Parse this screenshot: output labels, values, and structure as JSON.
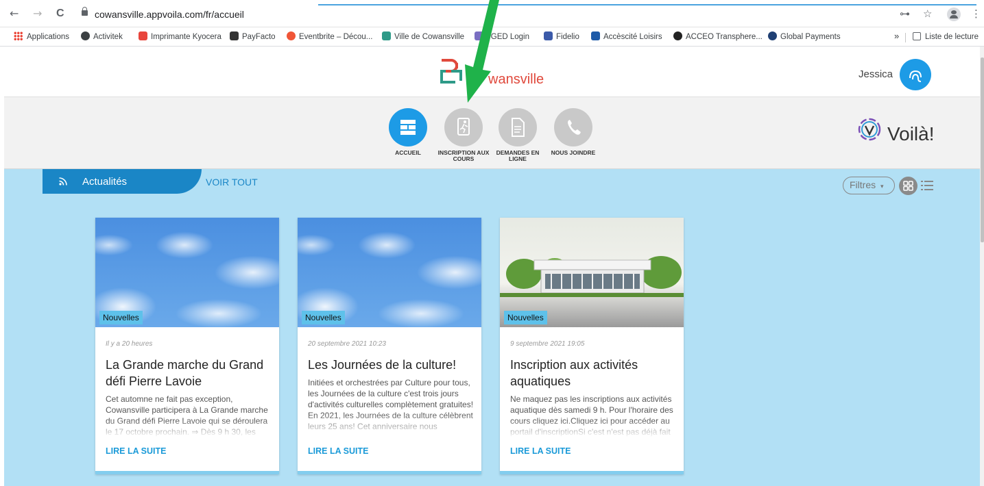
{
  "browser": {
    "url": "cowansville.appvoila.com/fr/accueil",
    "back_glyph": "←",
    "forward_glyph": "→",
    "reload_glyph": "C",
    "key_glyph": "⊶",
    "star_glyph": "☆",
    "menu_glyph": "⋮"
  },
  "bookmarks": {
    "items": [
      {
        "label": "Applications",
        "icon": "apps-grid-icon",
        "color": "#ea4335"
      },
      {
        "label": "Activitek",
        "icon": "activitek-icon",
        "color": "#3c4043"
      },
      {
        "label": "Imprimante Kyocera",
        "icon": "kyocera-icon",
        "color": "#e8453c"
      },
      {
        "label": "PayFacto",
        "icon": "payfacto-icon",
        "color": "#333333"
      },
      {
        "label": "Eventbrite – Décou...",
        "icon": "eventbrite-icon",
        "color": "#f05537"
      },
      {
        "label": "Ville de Cowansville",
        "icon": "cowansville-icon",
        "color": "#2e9a88"
      },
      {
        "label": "yGED Login",
        "icon": "yged-icon",
        "color": "#7a6fc2"
      },
      {
        "label": "Fidelio",
        "icon": "fidelio-icon",
        "color": "#3b5aa9"
      },
      {
        "label": "Accèscité Loisirs",
        "icon": "accescite-icon",
        "color": "#1e5ba8"
      },
      {
        "label": "ACCEO Transphere...",
        "icon": "acceo-icon",
        "color": "#222222"
      },
      {
        "label": "Global Payments",
        "icon": "global-payments-icon",
        "color": "#1f3f73"
      }
    ],
    "more_glyph": "»",
    "reading_list_label": "Liste de lecture"
  },
  "header": {
    "logo_text": "wansville",
    "user_name": "Jessica",
    "accent_color": "#1d9be6",
    "logo_color": "#e0493c"
  },
  "nav": {
    "items": [
      {
        "label_line1": "ACCUEIL",
        "label_line2": "",
        "icon": "home-grid-icon",
        "active": true
      },
      {
        "label_line1": "INSCRIPTION AUX",
        "label_line2": "COURS",
        "icon": "runner-icon",
        "active": false
      },
      {
        "label_line1": "DEMANDES EN",
        "label_line2": "LIGNE",
        "icon": "document-icon",
        "active": false
      },
      {
        "label_line1": "NOUS JOINDRE",
        "label_line2": "",
        "icon": "phone-icon",
        "active": false
      }
    ],
    "brand_text": "Voilà!"
  },
  "main": {
    "section_title": "Actualités",
    "see_all": "VOIR TOUT",
    "filter_label": "Filtres",
    "filter_caret": "▾",
    "background_color": "#b2e0f5",
    "cards": [
      {
        "badge": "Nouvelles",
        "date": "Il y a 20 heures",
        "title_line1": "La Grande marche du Grand",
        "title_line2": "défi Pierre Lavoie",
        "body": "Cet automne ne fait pas exception, Cowansville participera à La Grande marche du Grand défi Pierre Lavoie qui se déroulera le 17 octobre prochain. ⇒ Dès 9 h 30, les",
        "read_more": "LIRE LA SUITE"
      },
      {
        "badge": "Nouvelles",
        "date": "20 septembre 2021 10:23",
        "title_line1": "Les Journées de la culture!",
        "title_line2": "",
        "body": "Initiées et orchestrées par Culture pour tous, les Journées de la culture c'est trois jours d'activités culturelles complètement gratuites!  En 2021, les Journées de la culture célèbrent leurs 25 ans! Cet anniversaire nous",
        "read_more": "LIRE LA SUITE"
      },
      {
        "badge": "Nouvelles",
        "date": "9 septembre 2021 19:05",
        "title_line1": "Inscription aux activités",
        "title_line2": "aquatiques",
        "body": "Ne maquez pas les inscriptions aux activités aquatique dès samedi 9 h. Pour l'horaire des cours cliquez ici.Cliquez ici pour accéder au portail d'inscriptionSi c'est n'est pas déjà fait",
        "read_more": "LIRE LA SUITE"
      }
    ]
  },
  "annotation": {
    "arrow_color": "#1fb24a"
  }
}
